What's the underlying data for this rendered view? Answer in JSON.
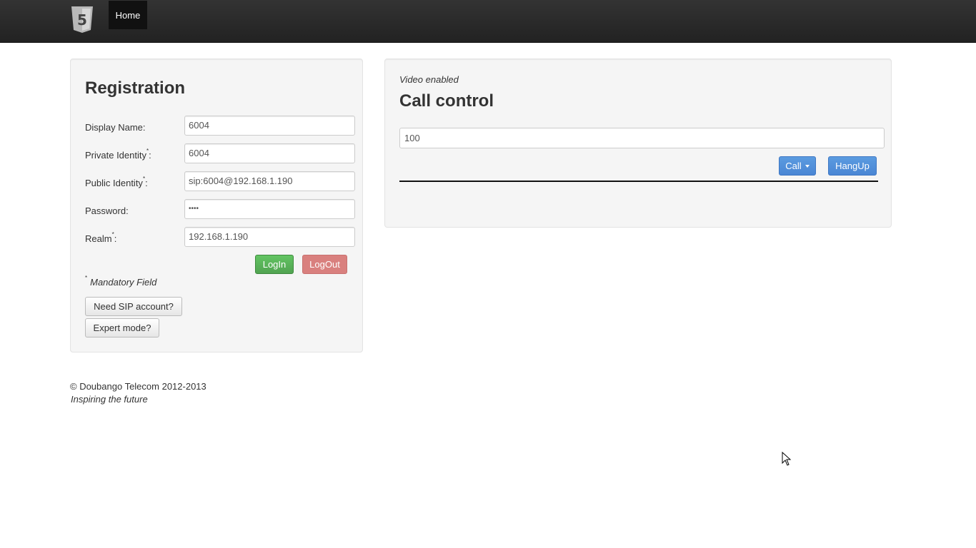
{
  "navbar": {
    "logo_icon": "html5-logo-icon",
    "logo_glyph": "5",
    "home_label": "Home"
  },
  "registration": {
    "title": "Registration",
    "fields": [
      {
        "label": "Display Name:",
        "required": false,
        "value": "6004"
      },
      {
        "label": "Private Identity",
        "required": true,
        "suffix": ":",
        "value": "6004"
      },
      {
        "label": "Public Identity",
        "required": true,
        "suffix": ":",
        "value": "sip:6004@192.168.1.190"
      },
      {
        "label": "Password:",
        "required": false,
        "value": "••••"
      },
      {
        "label": "Realm",
        "required": true,
        "suffix": ":",
        "value": "192.168.1.190"
      }
    ],
    "required_mark": "*",
    "login_label": "LogIn",
    "logout_label": "LogOut",
    "mandatory_note": "Mandatory Field",
    "need_sip_label": "Need SIP account?",
    "expert_mode_label": "Expert mode?"
  },
  "call_control": {
    "video_note": "Video enabled",
    "title": "Call control",
    "number_value": "100",
    "call_label": "Call",
    "hangup_label": "HangUp"
  },
  "footer": {
    "copyright": "© Doubango Telecom 2012-2013",
    "tagline": "Inspiring the future"
  },
  "colors": {
    "navbar": "#222222",
    "well": "#f5f5f5",
    "success": "#51a351",
    "danger": "#d9807e",
    "primary": "#4a86d4"
  }
}
